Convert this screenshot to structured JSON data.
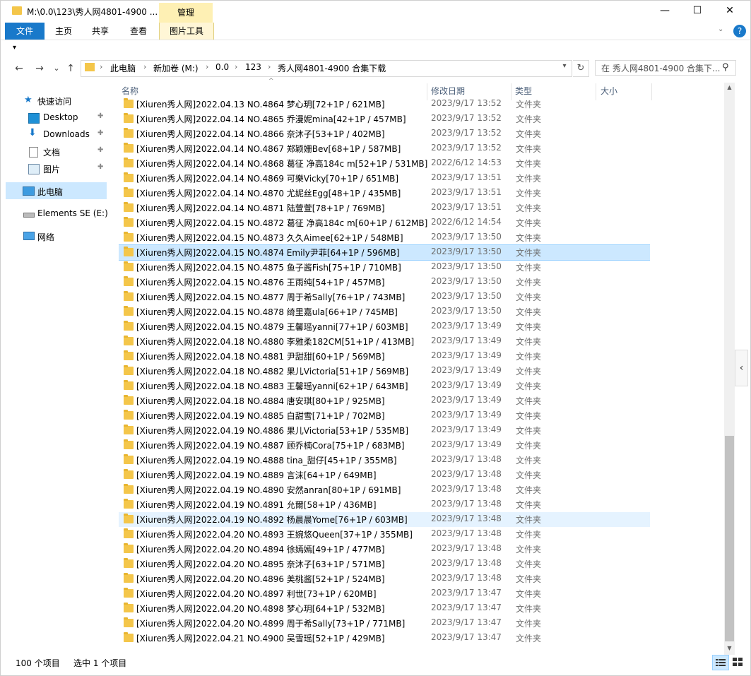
{
  "window": {
    "title": "M:\\0.0\\123\\秀人网4801-4900 ...",
    "manage_tab": "管理",
    "minimize": "—",
    "maximize": "☐",
    "close": "✕"
  },
  "ribbon": {
    "tabs": [
      "文件",
      "主页",
      "共享",
      "查看",
      "图片工具"
    ],
    "expand_icon": "chevron-down",
    "help_icon": "help"
  },
  "nav_buttons": {
    "back": "←",
    "forward": "→",
    "recent": "⌄",
    "up": "↑"
  },
  "address": {
    "crumbs": [
      "此电脑",
      "新加卷 (M:)",
      "0.0",
      "123",
      "秀人网4801-4900 合集下载"
    ]
  },
  "search": {
    "placeholder": "在 秀人网4801-4900 合集下..."
  },
  "nav_pane": {
    "quick_access": "快速访问",
    "items": [
      "Desktop",
      "Downloads",
      "文档",
      "图片"
    ],
    "this_pc": "此电脑",
    "drive": "Elements SE (E:)",
    "network": "网络"
  },
  "columns": {
    "name": "名称",
    "date": "修改日期",
    "type": "类型",
    "size": "大小"
  },
  "files": [
    {
      "name": "[Xiuren秀人网]2022.04.13 NO.4864 梦心玥[72+1P / 621MB]",
      "date": "2023/9/17 13:52",
      "type": "文件夹"
    },
    {
      "name": "[Xiuren秀人网]2022.04.14 NO.4865 乔漫妮mina[42+1P / 457MB]",
      "date": "2023/9/17 13:52",
      "type": "文件夹"
    },
    {
      "name": "[Xiuren秀人网]2022.04.14 NO.4866 奈沐子[53+1P / 402MB]",
      "date": "2023/9/17 13:52",
      "type": "文件夹"
    },
    {
      "name": "[Xiuren秀人网]2022.04.14 NO.4867 郑颖姗Bev[68+1P / 587MB]",
      "date": "2023/9/17 13:52",
      "type": "文件夹"
    },
    {
      "name": "[Xiuren秀人网]2022.04.14 NO.4868 葛征 净高184c m[52+1P / 531MB]",
      "date": "2022/6/12 14:53",
      "type": "文件夹"
    },
    {
      "name": "[Xiuren秀人网]2022.04.14 NO.4869 可樂Vicky[70+1P / 651MB]",
      "date": "2023/9/17 13:51",
      "type": "文件夹"
    },
    {
      "name": "[Xiuren秀人网]2022.04.14 NO.4870 尤妮丝Egg[48+1P / 435MB]",
      "date": "2023/9/17 13:51",
      "type": "文件夹"
    },
    {
      "name": "[Xiuren秀人网]2022.04.14 NO.4871 陆萱萱[78+1P / 769MB]",
      "date": "2023/9/17 13:51",
      "type": "文件夹"
    },
    {
      "name": "[Xiuren秀人网]2022.04.15 NO.4872 葛征 净高184c m[60+1P / 612MB]",
      "date": "2022/6/12 14:54",
      "type": "文件夹"
    },
    {
      "name": "[Xiuren秀人网]2022.04.15 NO.4873 久久Aimee[62+1P / 548MB]",
      "date": "2023/9/17 13:50",
      "type": "文件夹"
    },
    {
      "name": "[Xiuren秀人网]2022.04.15 NO.4874 Emily尹菲[64+1P / 596MB]",
      "date": "2023/9/17 13:50",
      "type": "文件夹",
      "state": "selected"
    },
    {
      "name": "[Xiuren秀人网]2022.04.15 NO.4875 鱼子酱Fish[75+1P / 710MB]",
      "date": "2023/9/17 13:50",
      "type": "文件夹"
    },
    {
      "name": "[Xiuren秀人网]2022.04.15 NO.4876 王雨纯[54+1P / 457MB]",
      "date": "2023/9/17 13:50",
      "type": "文件夹"
    },
    {
      "name": "[Xiuren秀人网]2022.04.15 NO.4877 周于希Sally[76+1P / 743MB]",
      "date": "2023/9/17 13:50",
      "type": "文件夹"
    },
    {
      "name": "[Xiuren秀人网]2022.04.15 NO.4878 绮里嘉ula[66+1P / 745MB]",
      "date": "2023/9/17 13:50",
      "type": "文件夹"
    },
    {
      "name": "[Xiuren秀人网]2022.04.15 NO.4879 王馨瑶yanni[77+1P / 603MB]",
      "date": "2023/9/17 13:49",
      "type": "文件夹"
    },
    {
      "name": "[Xiuren秀人网]2022.04.18 NO.4880 李雅柔182CM[51+1P / 413MB]",
      "date": "2023/9/17 13:49",
      "type": "文件夹"
    },
    {
      "name": "[Xiuren秀人网]2022.04.18 NO.4881 尹甜甜[60+1P / 569MB]",
      "date": "2023/9/17 13:49",
      "type": "文件夹"
    },
    {
      "name": "[Xiuren秀人网]2022.04.18 NO.4882 果儿Victoria[51+1P / 569MB]",
      "date": "2023/9/17 13:49",
      "type": "文件夹"
    },
    {
      "name": "[Xiuren秀人网]2022.04.18 NO.4883 王馨瑶yanni[62+1P / 643MB]",
      "date": "2023/9/17 13:49",
      "type": "文件夹"
    },
    {
      "name": "[Xiuren秀人网]2022.04.18 NO.4884 唐安琪[80+1P / 925MB]",
      "date": "2023/9/17 13:49",
      "type": "文件夹"
    },
    {
      "name": "[Xiuren秀人网]2022.04.19 NO.4885 白甜雪[71+1P / 702MB]",
      "date": "2023/9/17 13:49",
      "type": "文件夹"
    },
    {
      "name": "[Xiuren秀人网]2022.04.19 NO.4886 果儿Victoria[53+1P / 535MB]",
      "date": "2023/9/17 13:49",
      "type": "文件夹"
    },
    {
      "name": "[Xiuren秀人网]2022.04.19 NO.4887 顾乔楠Cora[75+1P / 683MB]",
      "date": "2023/9/17 13:49",
      "type": "文件夹"
    },
    {
      "name": "[Xiuren秀人网]2022.04.19 NO.4888 tina_甜仔[45+1P / 355MB]",
      "date": "2023/9/17 13:48",
      "type": "文件夹"
    },
    {
      "name": "[Xiuren秀人网]2022.04.19 NO.4889 言沫[64+1P / 649MB]",
      "date": "2023/9/17 13:48",
      "type": "文件夹"
    },
    {
      "name": "[Xiuren秀人网]2022.04.19 NO.4890 安然anran[80+1P / 691MB]",
      "date": "2023/9/17 13:48",
      "type": "文件夹"
    },
    {
      "name": "[Xiuren秀人网]2022.04.19 NO.4891 允爾[58+1P / 436MB]",
      "date": "2023/9/17 13:48",
      "type": "文件夹"
    },
    {
      "name": "[Xiuren秀人网]2022.04.19 NO.4892 杨晨晨Yome[76+1P / 603MB]",
      "date": "2023/9/17 13:48",
      "type": "文件夹",
      "state": "hover"
    },
    {
      "name": "[Xiuren秀人网]2022.04.20 NO.4893 王婉悠Queen[37+1P / 355MB]",
      "date": "2023/9/17 13:48",
      "type": "文件夹"
    },
    {
      "name": "[Xiuren秀人网]2022.04.20 NO.4894 徐嫣嫣[49+1P / 477MB]",
      "date": "2023/9/17 13:48",
      "type": "文件夹"
    },
    {
      "name": "[Xiuren秀人网]2022.04.20 NO.4895 奈沐子[63+1P / 571MB]",
      "date": "2023/9/17 13:48",
      "type": "文件夹"
    },
    {
      "name": "[Xiuren秀人网]2022.04.20 NO.4896 美桃酱[52+1P / 524MB]",
      "date": "2023/9/17 13:48",
      "type": "文件夹"
    },
    {
      "name": "[Xiuren秀人网]2022.04.20 NO.4897 利世[73+1P / 620MB]",
      "date": "2023/9/17 13:47",
      "type": "文件夹"
    },
    {
      "name": "[Xiuren秀人网]2022.04.20 NO.4898 梦心玥[64+1P / 532MB]",
      "date": "2023/9/17 13:47",
      "type": "文件夹"
    },
    {
      "name": "[Xiuren秀人网]2022.04.20 NO.4899 周于希Sally[73+1P / 771MB]",
      "date": "2023/9/17 13:47",
      "type": "文件夹"
    },
    {
      "name": "[Xiuren秀人网]2022.04.21 NO.4900 吴雪瑶[52+1P / 429MB]",
      "date": "2023/9/17 13:47",
      "type": "文件夹"
    }
  ],
  "status": {
    "count": "100 个项目",
    "selected": "选中 1 个项目"
  },
  "colors": {
    "accent": "#1979ca",
    "selection": "#cce8ff",
    "hover": "#e5f3ff",
    "folder": "#f4c64a",
    "manage_tab": "#fef0b4"
  }
}
